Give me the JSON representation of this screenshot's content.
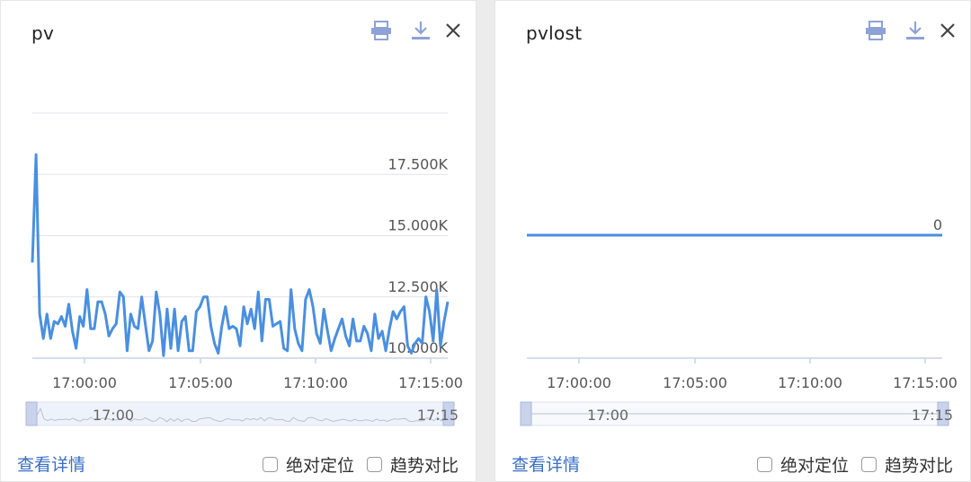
{
  "colors": {
    "line": "#4a8fe0",
    "grid": "#dfe3ea",
    "axis": "#c9d3e6",
    "link": "#3a6fc7",
    "icon": "#8ea2d8",
    "zoom_bg": "#eef2fa"
  },
  "panels": [
    {
      "title": "pv",
      "footer": {
        "link": "查看详情",
        "check1": "绝对定位",
        "check2": "趋势对比"
      },
      "icons": {
        "print": "print-icon",
        "download": "download-icon",
        "close": "close-icon"
      }
    },
    {
      "title": "pvlost",
      "footer": {
        "link": "查看详情",
        "check1": "绝对定位",
        "check2": "趋势对比"
      },
      "icons": {
        "print": "print-icon",
        "download": "download-icon",
        "close": "close-icon"
      }
    }
  ],
  "chart_data": [
    {
      "type": "line",
      "title": "pv",
      "x_ticks": [
        "17:00:00",
        "17:05:00",
        "17:10:00",
        "17:15:00"
      ],
      "y_ticks": [
        "10.000K",
        "12.500K",
        "15.000K",
        "17.500K"
      ],
      "ylim": [
        10000,
        20000
      ],
      "grid": true,
      "zoom_labels": [
        "17:00",
        "17:15"
      ],
      "series": [
        {
          "values": [
            13900,
            18300,
            11800,
            10800,
            11800,
            10800,
            11500,
            11400,
            11700,
            11300,
            12200,
            11100,
            10400,
            11700,
            11300,
            12800,
            11200,
            11200,
            12300,
            12300,
            11800,
            10900,
            11200,
            11400,
            12700,
            12500,
            10300,
            11800,
            11300,
            11200,
            12500,
            11400,
            10300,
            10700,
            12700,
            11800,
            10100,
            12000,
            10400,
            12000,
            10300,
            11500,
            11700,
            10300,
            10300,
            11900,
            12100,
            12500,
            12500,
            11300,
            10600,
            10200,
            11300,
            12100,
            11200,
            11300,
            11200,
            10500,
            12100,
            11400,
            12000,
            11200,
            12700,
            10700,
            12400,
            12400,
            11300,
            11400,
            11500,
            10400,
            10300,
            12800,
            11200,
            10600,
            10300,
            12400,
            12800,
            12100,
            11000,
            10600,
            12000,
            11100,
            10300,
            10800,
            11200,
            11600,
            10900,
            10500,
            11600,
            10700,
            10700,
            11300,
            11000,
            10300,
            11800,
            10800,
            11100,
            10300,
            11200,
            11900,
            11600,
            11900,
            12100,
            10500,
            10200,
            10600,
            10800,
            10600,
            12500,
            11900,
            10700,
            12800,
            10500,
            11500,
            12300
          ]
        }
      ]
    },
    {
      "type": "line",
      "title": "pvlost",
      "x_ticks": [
        "17:00:00",
        "17:05:00",
        "17:10:00",
        "17:15:00"
      ],
      "y_ticks": [
        "0"
      ],
      "ylim": [
        0,
        0
      ],
      "grid": true,
      "zoom_labels": [
        "17:00",
        "17:15"
      ],
      "series": [
        {
          "values": [
            0,
            0
          ]
        }
      ]
    }
  ]
}
